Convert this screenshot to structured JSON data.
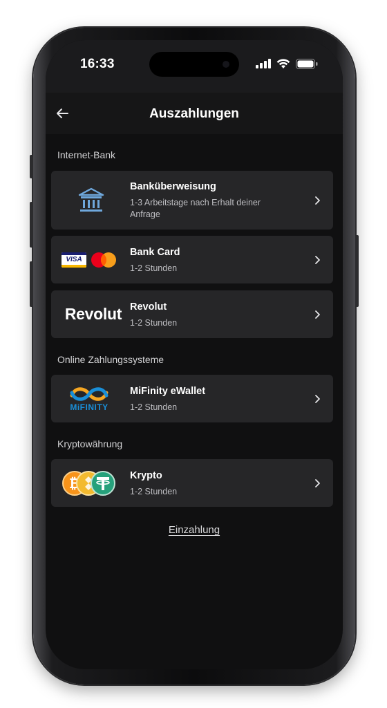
{
  "status_bar": {
    "time": "16:33"
  },
  "header": {
    "title": "Auszahlungen"
  },
  "sections": [
    {
      "label": "Internet-Bank",
      "methods": [
        {
          "name": "Banküberweisung",
          "desc": "1-3 Arbeitstage nach Erhalt deiner Anfrage",
          "logo": "bank-icon"
        },
        {
          "name": "Bank Card",
          "desc": "1-2 Stunden",
          "logo": "visa-mastercard-logo",
          "logo_text": "VISA"
        },
        {
          "name": "Revolut",
          "desc": "1-2 Stunden",
          "logo": "revolut-logo",
          "logo_text": "Revolut"
        }
      ]
    },
    {
      "label": "Online Zahlungssysteme",
      "methods": [
        {
          "name": "MiFinity eWallet",
          "desc": "1-2 Stunden",
          "logo": "mifinity-logo",
          "logo_text": "MiFINITY"
        }
      ]
    },
    {
      "label": "Kryptowährung",
      "methods": [
        {
          "name": "Krypto",
          "desc": "1-2 Stunden",
          "logo": "crypto-coins-icon"
        }
      ]
    }
  ],
  "footer": {
    "link_label": "Einzahlung"
  },
  "colors": {
    "background": "#101011",
    "card": "#262628",
    "text_primary": "#ffffff",
    "text_secondary": "#bdbdc1",
    "bank_icon": "#6fa8dc",
    "mifinity_blue": "#1a8fd8",
    "mifinity_orange": "#f5a623",
    "bitcoin": "#f7931a",
    "tether": "#26a17b"
  }
}
